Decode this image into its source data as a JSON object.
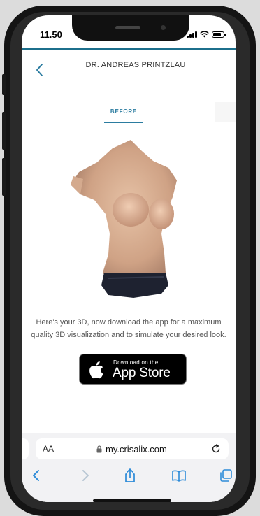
{
  "status_bar": {
    "time": "11.50"
  },
  "header": {
    "doctor_name": "DR. ANDREAS PRINTZLAU"
  },
  "tabs": [
    {
      "label": "BEFORE"
    }
  ],
  "content": {
    "message": "Here's your 3D, now download the app for a maximum quality 3D visualization and to simulate your desired look."
  },
  "app_store_badge": {
    "small_text": "Download on the",
    "big_text": "App Store"
  },
  "browser": {
    "text_size_label": "AA",
    "url": "my.crisalix.com"
  },
  "colors": {
    "accent": "#2b7ca0",
    "header_bar": "#1c6f8c",
    "toolbar_icons": "#2d8bd8"
  },
  "icons": [
    "back-chevron-icon",
    "lock-icon",
    "reload-icon",
    "share-icon",
    "bookmarks-icon",
    "tabs-icon",
    "apple-logo-icon"
  ]
}
